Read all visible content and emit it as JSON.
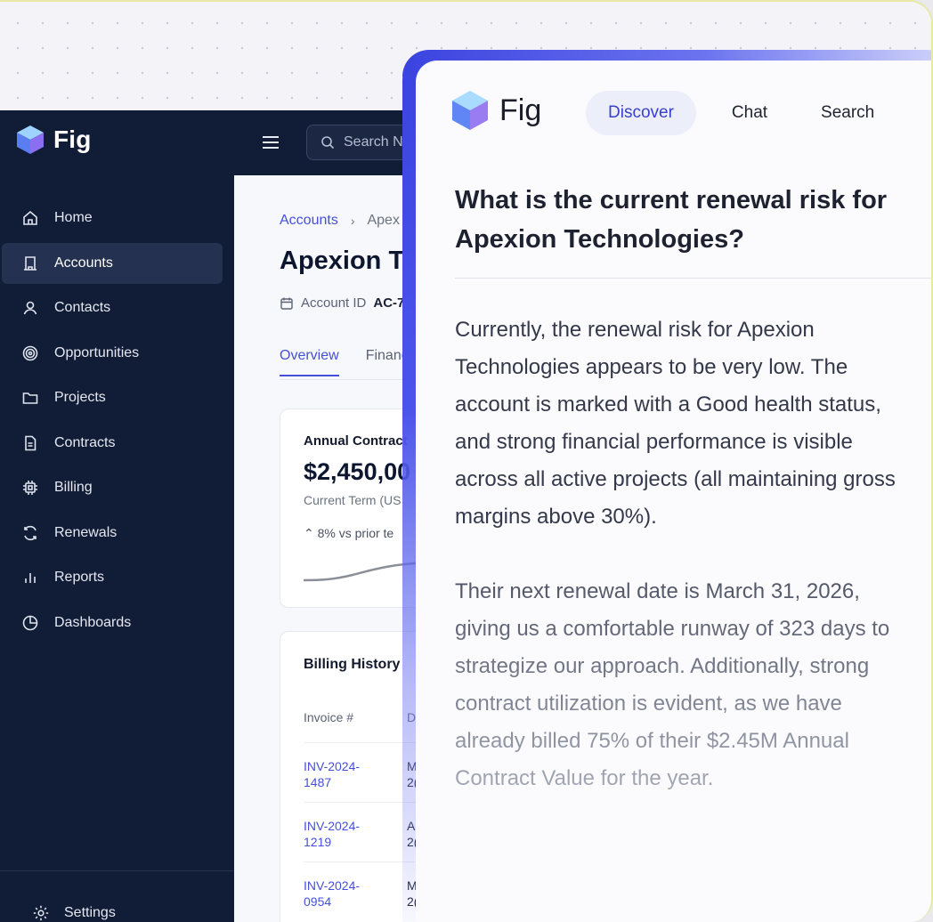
{
  "brand": {
    "name": "Fig"
  },
  "sidebar": {
    "items": [
      {
        "label": "Home",
        "icon": "home-icon"
      },
      {
        "label": "Accounts",
        "icon": "building-icon",
        "active": true
      },
      {
        "label": "Contacts",
        "icon": "user-icon"
      },
      {
        "label": "Opportunities",
        "icon": "target-icon"
      },
      {
        "label": "Projects",
        "icon": "folder-icon"
      },
      {
        "label": "Contracts",
        "icon": "document-icon"
      },
      {
        "label": "Billing",
        "icon": "chip-icon"
      },
      {
        "label": "Renewals",
        "icon": "refresh-icon"
      },
      {
        "label": "Reports",
        "icon": "bar-chart-icon"
      },
      {
        "label": "Dashboards",
        "icon": "pie-chart-icon"
      }
    ],
    "settings_label": "Settings"
  },
  "topbar": {
    "search_placeholder": "Search N"
  },
  "main": {
    "breadcrumb": {
      "root": "Accounts",
      "sep": "›",
      "current": "Apex"
    },
    "title": "Apexion Te",
    "account_id_label": "Account ID",
    "account_id_value": "AC-7",
    "tabs": [
      {
        "label": "Overview",
        "active": true
      },
      {
        "label": "Financ"
      }
    ],
    "contract_card": {
      "label": "Annual Contract",
      "value": "$2,450,00",
      "sub": "Current Term (US",
      "change": "⌃ 8% vs prior te"
    },
    "billing": {
      "title": "Billing History",
      "col_invoice": "Invoice #",
      "col_date": "D",
      "rows": [
        {
          "invoice": "INV-2024-1487",
          "inv_line1": "INV-2024-",
          "inv_line2": "1487",
          "d1": "M",
          "d2": "2("
        },
        {
          "invoice": "INV-2024-1219",
          "inv_line1": "INV-2024-",
          "inv_line2": "1219",
          "d1": "A",
          "d2": "2("
        },
        {
          "invoice": "INV-2024-0954",
          "inv_line1": "INV-2024-",
          "inv_line2": "0954",
          "d1": "M",
          "d2": "2("
        }
      ]
    }
  },
  "assistant": {
    "tabs": [
      {
        "label": "Discover",
        "active": true
      },
      {
        "label": "Chat"
      },
      {
        "label": "Search"
      }
    ],
    "question": "What is the current renewal risk for Apexion Technologies?",
    "answer_p1": "Currently, the renewal risk for Apexion Technologies appears to be very low. The account is marked with a Good health status, and strong financial performance is visible across all active projects (all maintaining gross margins above 30%).",
    "answer_p2": "Their next renewal date is March 31, 2026, giving us a comfortable runway of 323 days to strategize our approach. Additionally, strong contract utilization is evident, as we have already billed 75% of their $2.45M Annual Contract Value for the year."
  },
  "colors": {
    "sidebar_bg": "#111c36",
    "accent": "#4550d8",
    "panel_border": "#3b43e0"
  }
}
